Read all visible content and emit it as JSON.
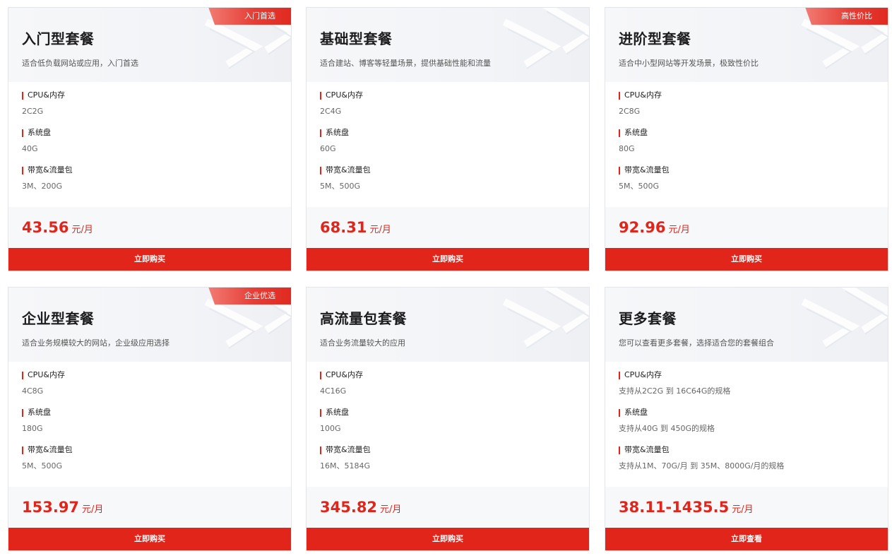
{
  "colors": {
    "accent": "#e1251b",
    "badge_start": "#f27b72",
    "header_bg": "#f4f5f8",
    "price_bg": "#f7f8fa"
  },
  "spec_labels": {
    "cpu": "CPU&内存",
    "disk": "系统盘",
    "bandwidth": "带宽&流量包"
  },
  "price_unit": "元/月",
  "cards": [
    {
      "title": "入门型套餐",
      "badge": "入门首选",
      "desc": "适合低负载网站或应用，入门首选",
      "cpu": "2C2G",
      "disk": "40G",
      "bandwidth": "3M、200G",
      "price": "43.56",
      "button": "立即购买"
    },
    {
      "title": "基础型套餐",
      "badge": "",
      "desc": "适合建站、博客等轻量场景，提供基础性能和流量",
      "cpu": "2C4G",
      "disk": "60G",
      "bandwidth": "5M、500G",
      "price": "68.31",
      "button": "立即购买"
    },
    {
      "title": "进阶型套餐",
      "badge": "高性价比",
      "desc": "适合中小型网站等开发场景，极致性价比",
      "cpu": "2C8G",
      "disk": "80G",
      "bandwidth": "5M、500G",
      "price": "92.96",
      "button": "立即购买"
    },
    {
      "title": "企业型套餐",
      "badge": "企业优选",
      "desc": "适合业务规模较大的网站，企业级应用选择",
      "cpu": "4C8G",
      "disk": "180G",
      "bandwidth": "5M、500G",
      "price": "153.97",
      "button": "立即购买"
    },
    {
      "title": "高流量包套餐",
      "badge": "",
      "desc": "适合业务流量较大的应用",
      "cpu": "4C16G",
      "disk": "100G",
      "bandwidth": "16M、5184G",
      "price": "345.82",
      "button": "立即购买"
    },
    {
      "title": "更多套餐",
      "badge": "",
      "desc": "您可以查看更多套餐，选择适合您的套餐组合",
      "cpu": "支持从2C2G 到 16C64G的规格",
      "disk": "支持从40G 到 450G的规格",
      "bandwidth": "支持从1M、70G/月 到 35M、8000G/月的规格",
      "price": "38.11-1435.5",
      "button": "立即查看"
    }
  ]
}
